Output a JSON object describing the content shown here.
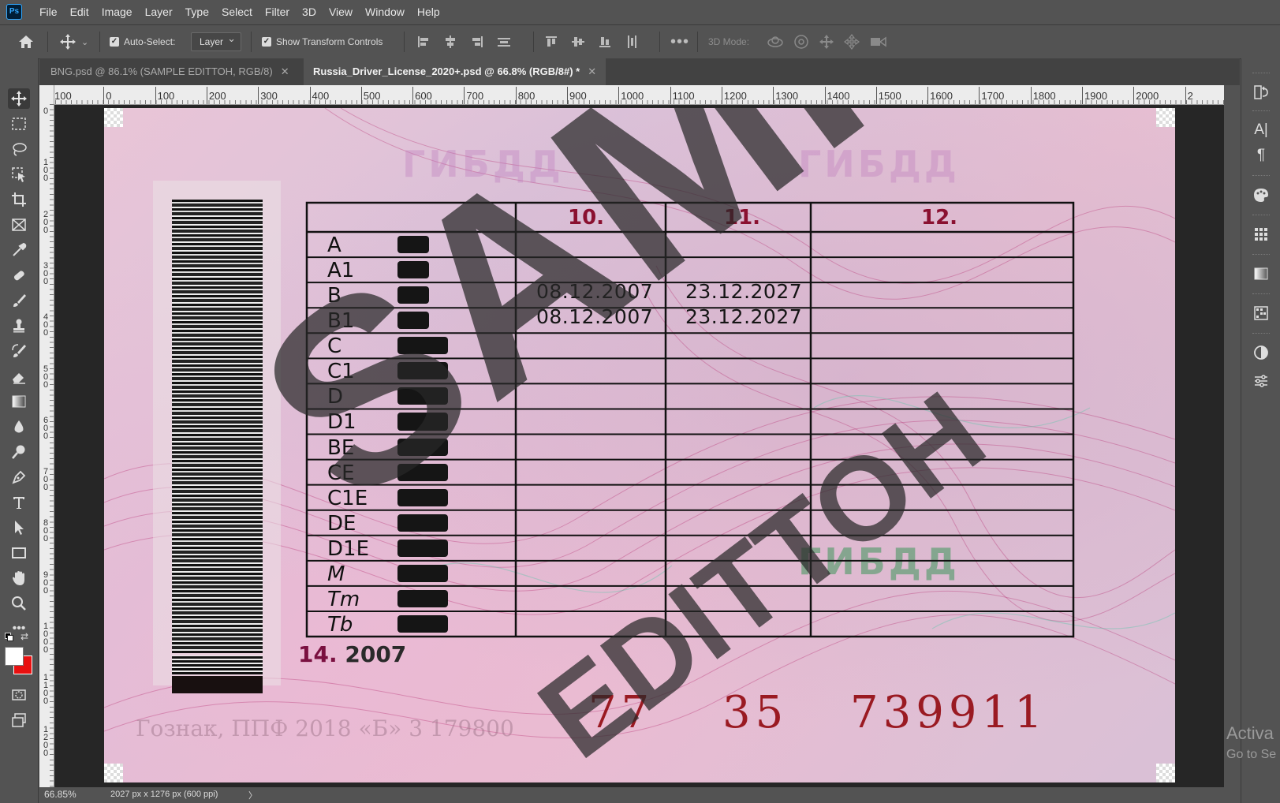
{
  "menu": [
    "File",
    "Edit",
    "Image",
    "Layer",
    "Type",
    "Select",
    "Filter",
    "3D",
    "View",
    "Window",
    "Help"
  ],
  "app_logo": "Ps",
  "options": {
    "auto_select_label": "Auto-Select:",
    "auto_select_checked": true,
    "layer_dropdown": "Layer",
    "show_transform_label": "Show Transform Controls",
    "show_transform_checked": true,
    "mode_3d_label": "3D Mode:"
  },
  "tabs": [
    {
      "label": "BNG.psd @ 86.1% (SAMPLE   EDITTOH, RGB/8)",
      "active": false
    },
    {
      "label": "Russia_Driver_License_2020+.psd @ 66.8% (RGB/8#) *",
      "active": true
    }
  ],
  "hruler": [
    "100",
    "0",
    "100",
    "200",
    "300",
    "400",
    "500",
    "600",
    "700",
    "800",
    "900",
    "1000",
    "1100",
    "1200",
    "1300",
    "1400",
    "1500",
    "1600",
    "1700",
    "1800",
    "1900",
    "2000",
    "2"
  ],
  "vruler": [
    "0",
    "1\n0\n0",
    "2\n0\n0",
    "3\n0\n0",
    "4\n0\n0",
    "5\n0\n0",
    "6\n0\n0",
    "7\n0\n0",
    "8\n0\n0",
    "9\n0\n0",
    "1\n0\n0\n0",
    "1\n1\n0\n0",
    "1\n2\n0\n0"
  ],
  "document": {
    "col_headers": [
      "10.",
      "11.",
      "12."
    ],
    "categories": [
      "A",
      "A1",
      "B",
      "B1",
      "C",
      "C1",
      "D",
      "D1",
      "BE",
      "CE",
      "C1E",
      "DE",
      "D1E",
      "M",
      "Tm",
      "Tb"
    ],
    "date_rows": [
      {
        "issued": "08.12.2007",
        "expires": "23.12.2027"
      },
      {
        "issued": "08.12.2007",
        "expires": "23.12.2027"
      }
    ],
    "field14_num": "14.",
    "field14_value": "2007",
    "serial": [
      "77",
      "35",
      "739911"
    ],
    "watermark_sample": "SAMPLE",
    "watermark_edition": "EDITTOH",
    "gibdd": [
      "ГИБДД",
      "ГИБДД",
      "ГИБДД"
    ],
    "goznak": "Гознак, ППФ         2018   «Б»   3  179800"
  },
  "status": {
    "zoom": "66.85%",
    "doc_info": "2027 px x 1276 px (600 ppi)",
    "arrow": "〉"
  },
  "activate": {
    "line1": "Activa",
    "line2": "Go to Se"
  },
  "colors": {
    "foreground": "#ffffff",
    "background": "#e81010",
    "accent": "#31a8ff"
  }
}
